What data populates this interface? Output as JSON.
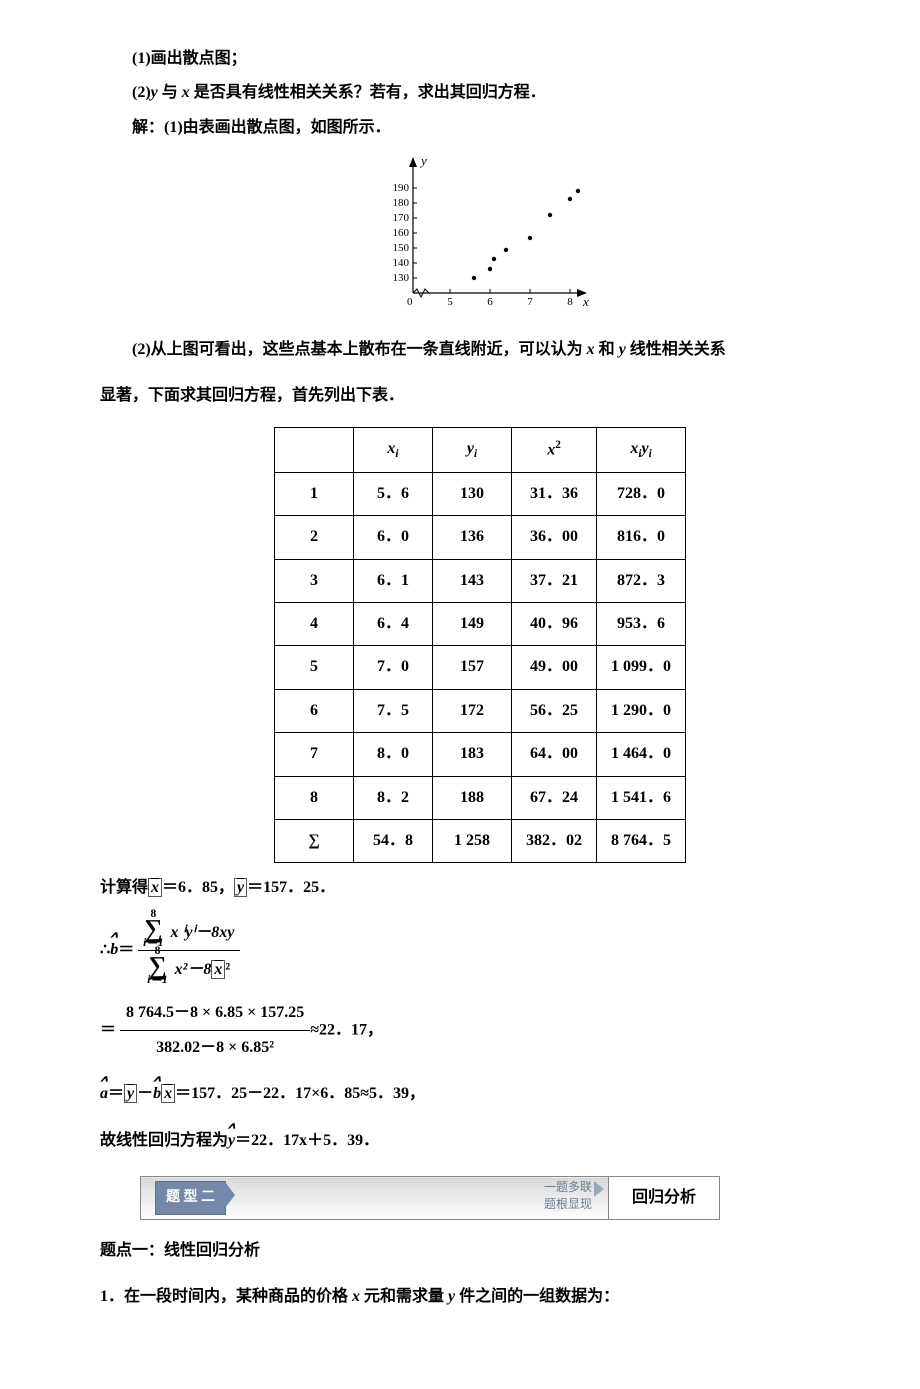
{
  "lines": {
    "q1": "(1)画出散点图；",
    "q2_pre": "(2)",
    "q2_var_y": "y",
    "q2_mid1": " 与 ",
    "q2_var_x": "x",
    "q2_post": " 是否具有线性相关关系？若有，求出其回归方程．",
    "sol_label": "解：(1)",
    "sol1": "由表画出散点图，如图所示．",
    "sol2_pre": "(2)从上图可看出，这些点基本上散布在一条直线附近，可以认为 ",
    "sol2_x": "x",
    "sol2_and": " 和 ",
    "sol2_y": "y",
    "sol2_post": " 线性相关关系",
    "sol2_line2": "显著，下面求其回归方程，首先列出下表．",
    "compute_pre": "计算得",
    "xbar_sym": "x",
    "xbar_eq": "＝6．85，",
    "ybar_sym": "y",
    "ybar_eq": "＝157．25．",
    "therefore": "∴",
    "bhat": "b",
    "equals": "＝",
    "frac2_num": "8 764.5－8 × 6.85 × 157.25",
    "frac2_den": "382.02－8 × 6.85²",
    "approx_b": "≈22．17，",
    "ahat": "a",
    "a_expr": "＝157．25－22．17×6．85≈5．39，",
    "final_pre": "故线性回归方程为",
    "yhat": "y",
    "final_eq": "＝22．17x＋5．39．",
    "subhead": "题点一：线性回归分析",
    "prob1_pre": "1．在一段时间内，某种商品的价格 ",
    "prob1_x": "x",
    "prob1_mid": " 元和需求量 ",
    "prob1_y": "y",
    "prob1_post": " 件之间的一组数据为："
  },
  "chart_data": {
    "type": "scatter",
    "xlabel": "x",
    "ylabel": "y",
    "xlim": [
      4.5,
      8.5
    ],
    "ylim": [
      125,
      195
    ],
    "xticks": [
      5,
      6,
      7,
      8
    ],
    "yticks": [
      130,
      140,
      150,
      160,
      170,
      180,
      190
    ],
    "points": [
      {
        "x": 5.6,
        "y": 130
      },
      {
        "x": 6.0,
        "y": 136
      },
      {
        "x": 6.1,
        "y": 143
      },
      {
        "x": 6.4,
        "y": 149
      },
      {
        "x": 7.0,
        "y": 157
      },
      {
        "x": 7.5,
        "y": 172
      },
      {
        "x": 8.0,
        "y": 183
      },
      {
        "x": 8.2,
        "y": 188
      }
    ]
  },
  "table": {
    "headers": [
      "",
      "xᵢ",
      "yᵢ",
      "x²",
      "xᵢyᵢ"
    ],
    "header_raw": {
      "xi": "x",
      "xi_sub": "i",
      "yi": "y",
      "yi_sub": "i",
      "x2": "x",
      "x2_sup": "2",
      "xiyi_x": "x",
      "xiyi_is": "i",
      "xiyi_y": "y",
      "xiyi_is2": "i"
    },
    "rows": [
      [
        "1",
        "5．6",
        "130",
        "31．36",
        "728．0"
      ],
      [
        "2",
        "6．0",
        "136",
        "36．00",
        "816．0"
      ],
      [
        "3",
        "6．1",
        "143",
        "37．21",
        "872．3"
      ],
      [
        "4",
        "6．4",
        "149",
        "40．96",
        "953．6"
      ],
      [
        "5",
        "7．0",
        "157",
        "49．00",
        "1 099．0"
      ],
      [
        "6",
        "7．5",
        "172",
        "56．25",
        "1 290．0"
      ],
      [
        "7",
        "8．0",
        "183",
        "64．00",
        "1 464．0"
      ],
      [
        "8",
        "8．2",
        "188",
        "67．24",
        "1 541．6"
      ],
      [
        "∑",
        "54．8",
        "1 258",
        "382．02",
        "8 764．5"
      ]
    ]
  },
  "sigma": {
    "upper": "8",
    "lower": "i＝1"
  },
  "b_num_tail": "x ⁱyⁱ－8xy",
  "b_den_tail_a": "x²－8",
  "b_den_tail_b": "x",
  "b_den_tail_c": "²",
  "a_mid_minus": "－",
  "banner": {
    "tag": "题 型 二",
    "note1": "一题多联",
    "note2": "题根显现",
    "right": "回归分析"
  }
}
